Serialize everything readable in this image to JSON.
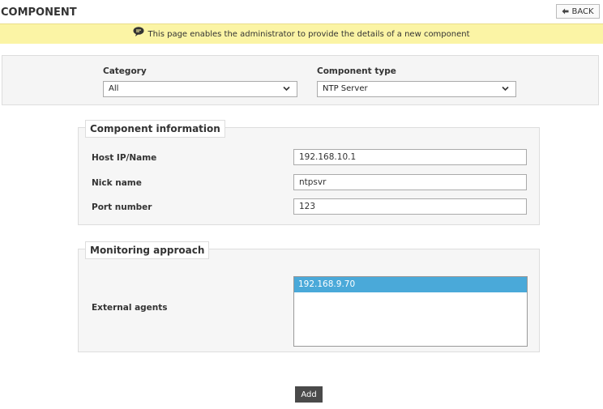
{
  "header": {
    "title": "COMPONENT",
    "back_label": "BACK"
  },
  "notice": {
    "text": "This page enables the administrator to provide the details of a new component",
    "icon": "speech-bubble-icon"
  },
  "selectors": {
    "category": {
      "label": "Category",
      "value": "All"
    },
    "component_type": {
      "label": "Component type",
      "value": "NTP Server"
    }
  },
  "component_info": {
    "legend": "Component information",
    "fields": [
      {
        "label": "Host IP/Name",
        "value": "192.168.10.1"
      },
      {
        "label": "Nick name",
        "value": "ntpsvr"
      },
      {
        "label": "Port number",
        "value": "123"
      }
    ]
  },
  "monitoring": {
    "legend": "Monitoring approach",
    "agents_label": "External agents",
    "agents": [
      {
        "value": "192.168.9.70",
        "selected": true
      }
    ]
  },
  "actions": {
    "add_label": "Add"
  },
  "colors": {
    "notice_bg": "#fbf4a5",
    "selected_item": "#4aa9d9",
    "add_button": "#4a4a4a"
  }
}
